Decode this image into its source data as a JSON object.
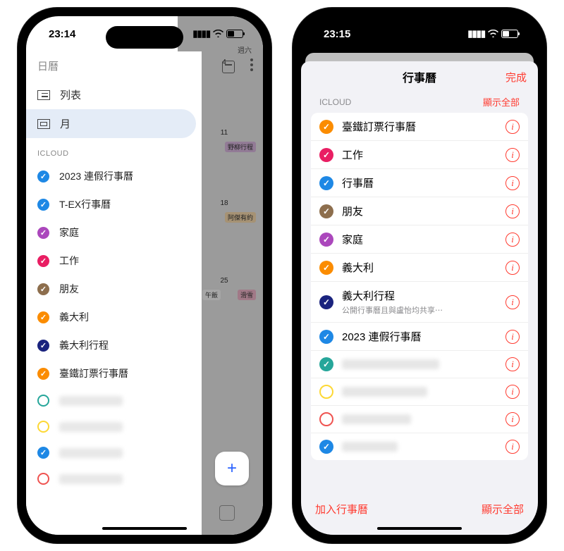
{
  "left": {
    "status_time": "23:14",
    "sidebar_title": "日曆",
    "view_list_label": "列表",
    "view_month_label": "月",
    "icloud_header": "ICLOUD",
    "calendars": [
      {
        "name": "2023 連假行事曆",
        "color": "#1e88e5",
        "checked": true
      },
      {
        "name": "T-EX行事曆",
        "color": "#1e88e5",
        "checked": true
      },
      {
        "name": "家庭",
        "color": "#ab47bc",
        "checked": true
      },
      {
        "name": "工作",
        "color": "#e91e63",
        "checked": true
      },
      {
        "name": "朋友",
        "color": "#8d6e4d",
        "checked": true
      },
      {
        "name": "義大利",
        "color": "#fb8c00",
        "checked": true
      },
      {
        "name": "義大利行程",
        "color": "#1a237e",
        "checked": true
      },
      {
        "name": "臺鐵訂票行事曆",
        "color": "#fb8c00",
        "checked": true
      }
    ],
    "blurred": [
      {
        "color": "#26a69a",
        "checked": false
      },
      {
        "color": "#fdd835",
        "checked": false
      },
      {
        "color": "#1e88e5",
        "checked": true
      },
      {
        "color": "#ef5350",
        "checked": false
      }
    ],
    "bg": {
      "day_sat_label": "週六",
      "dates": [
        "4",
        "11",
        "18",
        "25"
      ],
      "chip1": "野柳行程",
      "chip2": "阿傑有約",
      "chip3_left": "午飯",
      "chip3_right": "滑雪",
      "fab_plus": "+"
    }
  },
  "right": {
    "status_time": "23:15",
    "title": "行事曆",
    "done": "完成",
    "icloud_header": "ICLOUD",
    "show_all": "顯示全部",
    "calendars": [
      {
        "name": "臺鐵訂票行事曆",
        "sub": "",
        "color": "#fb8c00",
        "checked": true
      },
      {
        "name": "工作",
        "sub": "",
        "color": "#e91e63",
        "checked": true
      },
      {
        "name": "行事曆",
        "sub": "",
        "color": "#1e88e5",
        "checked": true
      },
      {
        "name": "朋友",
        "sub": "",
        "color": "#8d6e4d",
        "checked": true
      },
      {
        "name": "家庭",
        "sub": "",
        "color": "#ab47bc",
        "checked": true
      },
      {
        "name": "義大利",
        "sub": "",
        "color": "#fb8c00",
        "checked": true
      },
      {
        "name": "義大利行程",
        "sub": "公開行事曆且與盧怡均共享⋯",
        "color": "#1a237e",
        "checked": true
      },
      {
        "name": "2023 連假行事曆",
        "sub": "",
        "color": "#1e88e5",
        "checked": true
      }
    ],
    "blurred": [
      {
        "color": "#26a69a",
        "checked": true
      },
      {
        "color": "#fdd835",
        "checked": false
      },
      {
        "color": "#ef5350",
        "checked": false
      },
      {
        "color": "#1e88e5",
        "checked": true
      }
    ],
    "add_label": "加入行事曆",
    "show_all_bottom": "顯示全部"
  }
}
